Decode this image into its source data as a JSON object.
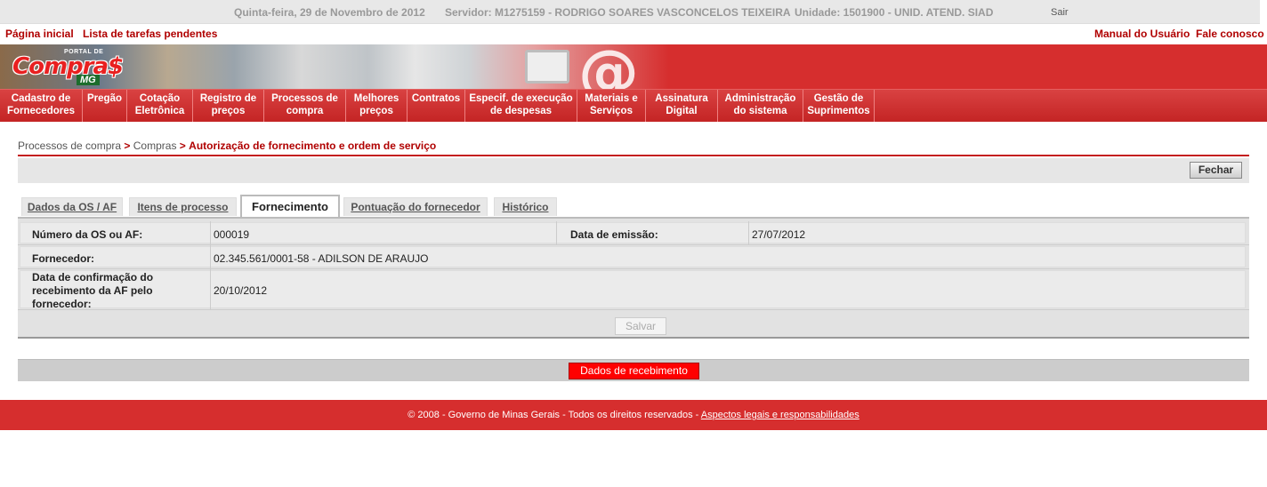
{
  "topbar": {
    "date": "Quinta-feira, 29 de Novembro de 2012",
    "servidor": "Servidor: M1275159 - RODRIGO SOARES VASCONCELOS TEIXEIRA",
    "unidade": "Unidade: 1501900 - UNID. ATEND. SIAD",
    "logout": "Sair"
  },
  "links": {
    "home": "Página inicial",
    "tasks": "Lista de tarefas pendentes",
    "manual": "Manual do Usuário",
    "contact": "Fale conosco"
  },
  "logo": {
    "portal": "PORTAL DE",
    "compras": "Compra$",
    "mg": "MG"
  },
  "menu": [
    {
      "line1": "Cadastro de",
      "line2": "Fornecedores"
    },
    {
      "line1": "Pregão",
      "line2": ""
    },
    {
      "line1": "Cotação",
      "line2": "Eletrônica"
    },
    {
      "line1": "Registro de",
      "line2": "preços"
    },
    {
      "line1": "Processos de",
      "line2": "compra"
    },
    {
      "line1": "Melhores",
      "line2": "preços"
    },
    {
      "line1": "Contratos",
      "line2": ""
    },
    {
      "line1": "Especif. de execução",
      "line2": "de despesas"
    },
    {
      "line1": "Materiais e",
      "line2": "Serviços"
    },
    {
      "line1": "Assinatura",
      "line2": "Digital"
    },
    {
      "line1": "Administração",
      "line2": "do sistema"
    },
    {
      "line1": "Gestão de",
      "line2": "Suprimentos"
    }
  ],
  "breadcrumb": {
    "part1": "Processos de compra",
    "sep": ">",
    "part2": "Compras",
    "part3": "Autorização de fornecimento e ordem de serviço"
  },
  "toolbar": {
    "close_label": "Fechar"
  },
  "tabs": [
    {
      "label": "Dados da OS / AF"
    },
    {
      "label": "Itens de processo"
    },
    {
      "label": "Fornecimento"
    },
    {
      "label": "Pontuação do fornecedor"
    },
    {
      "label": "Histórico"
    }
  ],
  "form": {
    "numero_label": "Número da OS ou AF:",
    "numero_value": "000019",
    "emissao_label": "Data de emissão:",
    "emissao_value": "27/07/2012",
    "fornecedor_label": "Fornecedor:",
    "fornecedor_value": "02.345.561/0001-58 - ADILSON DE ARAUJO",
    "confirmacao_label": "Data de confirmação do recebimento da AF pelo fornecedor:",
    "confirmacao_value": "20/10/2012",
    "save_label": "Salvar"
  },
  "recebimento": {
    "button_label": "Dados de recebimento"
  },
  "footer": {
    "text": "© 2008 - Governo de Minas Gerais - Todos os direitos reservados - ",
    "link": "Aspectos legais e responsabilidades"
  },
  "colors": {
    "brand_red": "#d62e2e",
    "dark_red": "#b00000",
    "button_red": "#ff0000"
  }
}
